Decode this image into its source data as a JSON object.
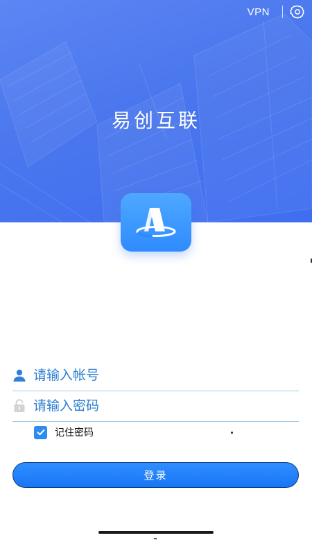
{
  "header": {
    "vpn_label": "VPN",
    "settings_icon": "gear-icon"
  },
  "app": {
    "title": "易创互联",
    "logo_icon": "app-logo-icon"
  },
  "form": {
    "account": {
      "placeholder": "请输入帐号",
      "value": "",
      "icon": "user-icon"
    },
    "password": {
      "placeholder": "请输入密码",
      "value": "",
      "icon": "lock-icon"
    },
    "remember": {
      "label": "记住密码",
      "checked": true
    },
    "login_label": "登录"
  },
  "colors": {
    "hero_blue": "#4a77ee",
    "accent_blue": "#1976f4",
    "field_line": "#9cc8e8",
    "placeholder_text": "#2d7fd3"
  }
}
